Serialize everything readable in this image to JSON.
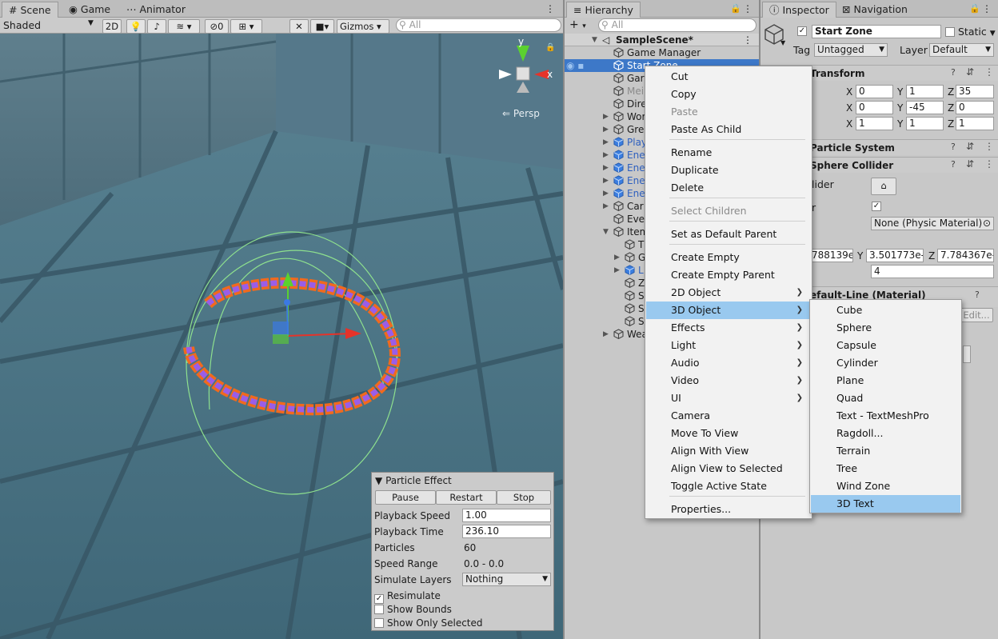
{
  "scene_tabs": {
    "scene": "Scene",
    "game": "Game",
    "animator": "Animator"
  },
  "scene_toolbar": {
    "shading": "Shaded",
    "mode_2d": "2D",
    "hidden_count": "0",
    "gizmos": "Gizmos",
    "search_placeholder": "All"
  },
  "gizmo": {
    "y": "y",
    "x": "x",
    "persp": "Persp"
  },
  "particle_panel": {
    "title": "Particle Effect",
    "pause": "Pause",
    "restart": "Restart",
    "stop": "Stop",
    "rows": [
      {
        "label": "Playback Speed",
        "value": "1.00"
      },
      {
        "label": "Playback Time",
        "value": "236.10"
      },
      {
        "label": "Particles",
        "value": "60"
      },
      {
        "label": "Speed Range",
        "value": "0.0 - 0.0"
      },
      {
        "label": "Simulate Layers",
        "value": "Nothing"
      }
    ],
    "resimulate": "Resimulate",
    "show_bounds": "Show Bounds",
    "show_only_selected": "Show Only Selected"
  },
  "hierarchy": {
    "tab": "Hierarchy",
    "search_placeholder": "All",
    "scene_name": "SampleScene*",
    "rows": [
      "Game Manager",
      "Start Zone",
      "Gar",
      "Mei",
      "Dire",
      "Wor",
      "Gre",
      "Play",
      "Ene",
      "Ene",
      "Ene",
      "Ene",
      "Car",
      "Eve",
      "Item",
      "T",
      "G",
      "L",
      "Z",
      "S",
      "S",
      "S",
      "Wea"
    ]
  },
  "inspector": {
    "tab": "Inspector",
    "nav_tab": "Navigation",
    "name": "Start Zone",
    "static": "Static",
    "tag_label": "Tag",
    "tag_value": "Untagged",
    "layer_label": "Layer",
    "layer_value": "Default",
    "transform": "Transform",
    "pos": {
      "x": "0",
      "y": "1",
      "z": "35"
    },
    "rot": {
      "x": "0",
      "y": "-45",
      "z": "0"
    },
    "scale": {
      "x": "1",
      "y": "1",
      "z": "1"
    },
    "particle_system": "Particle System",
    "sphere_collider": "Sphere Collider",
    "collider_label": "lider",
    "trigger_label": "r",
    "material": "None (Physic Material)",
    "center_x": "788139e-",
    "center_y": "3.501773e-",
    "center_z": "7.784367e-",
    "radius": "4",
    "material_section": "efault-Line (Material)",
    "edit": "Edit..."
  },
  "context_menu": {
    "items": [
      "Cut",
      "Copy",
      "Paste",
      "Paste As Child",
      "Rename",
      "Duplicate",
      "Delete",
      "Select Children",
      "Set as Default Parent",
      "Create Empty",
      "Create Empty Parent",
      "2D Object",
      "3D Object",
      "Effects",
      "Light",
      "Audio",
      "Video",
      "UI",
      "Camera",
      "Move To View",
      "Align With View",
      "Align View to Selected",
      "Toggle Active State",
      "Properties..."
    ]
  },
  "submenu": {
    "items": [
      "Cube",
      "Sphere",
      "Capsule",
      "Cylinder",
      "Plane",
      "Quad",
      "Text - TextMeshPro",
      "Ragdoll...",
      "Terrain",
      "Tree",
      "Wind Zone",
      "3D Text"
    ]
  },
  "colors": {
    "selection": "#3d78c8",
    "menu_highlight": "#99c9ef",
    "gizmo_red": "#e5332a",
    "gizmo_green": "#5bd12f",
    "particle_orange": "#f06a1e",
    "particle_purple": "#9a5de8"
  }
}
